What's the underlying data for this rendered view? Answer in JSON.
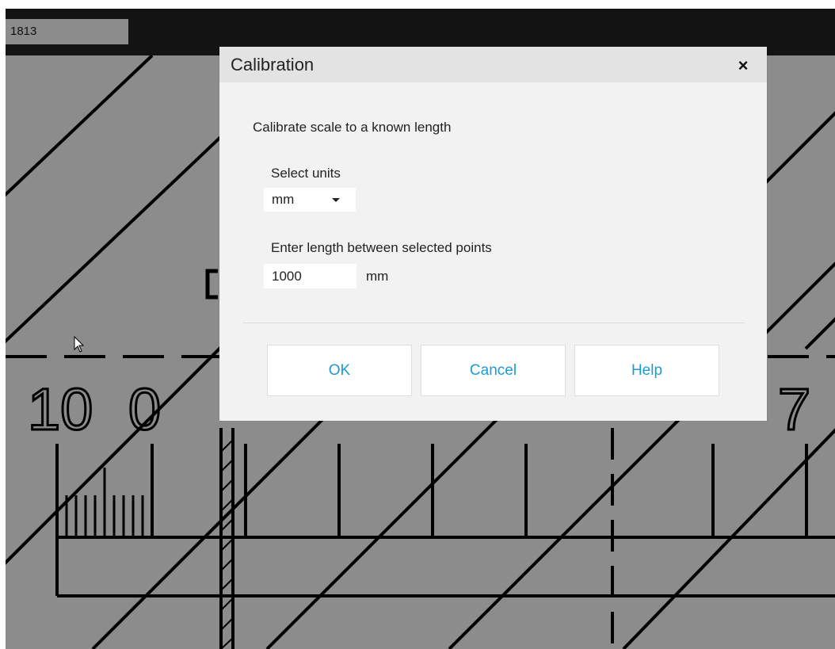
{
  "toolbar": {
    "page_number": "1813"
  },
  "drawing": {
    "labels": [
      "10",
      "0",
      "7"
    ]
  },
  "dialog": {
    "title": "Calibration",
    "close_glyph": "×",
    "subtitle": "Calibrate scale to a known length",
    "units_label": "Select units",
    "units_selected": "mm",
    "length_label": "Enter length between selected points",
    "length_value": "1000",
    "length_unit": "mm"
  },
  "buttons": {
    "ok": "OK",
    "cancel": "Cancel",
    "help": "Help"
  },
  "colors": {
    "accent": "#1a9ad6",
    "canvas": "#8c8c8c",
    "toolbar": "#131313",
    "dialog_bg": "#f2f2f2",
    "dialog_header": "#e3e3e3"
  },
  "icons": {
    "close": "close-icon",
    "dropdown": "chevron-down-icon",
    "cursor": "mouse-pointer-icon"
  }
}
